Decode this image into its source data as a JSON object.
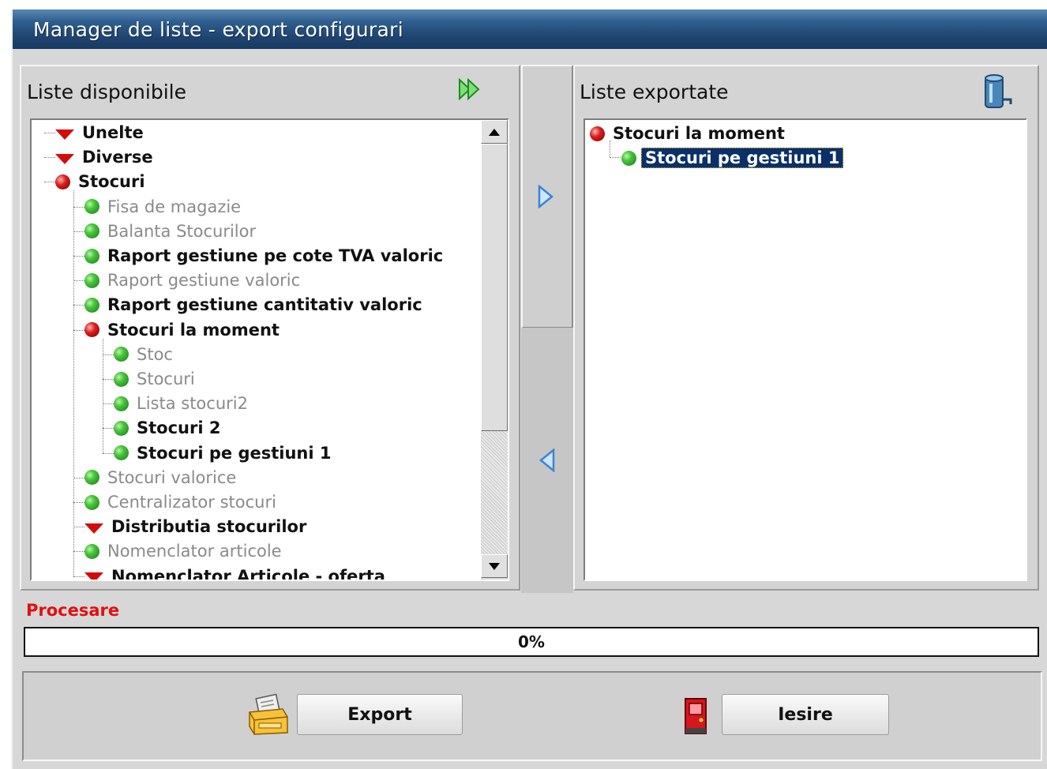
{
  "window": {
    "title": "Manager de liste  - export configurari"
  },
  "left_panel": {
    "title": "Liste disponibile",
    "add_all_icon": "double-arrow-right-icon",
    "items": [
      {
        "label": "Unelte",
        "icon": "chevron-down-icon",
        "style": "bold",
        "level": 0
      },
      {
        "label": "Diverse",
        "icon": "chevron-down-icon",
        "style": "bold",
        "level": 0
      },
      {
        "label": "Stocuri",
        "icon": "red-dot-icon",
        "style": "bold",
        "level": 0
      },
      {
        "label": "Fisa de magazie",
        "icon": "green-dot-icon",
        "style": "dim",
        "level": 1
      },
      {
        "label": "Balanta Stocurilor",
        "icon": "green-dot-icon",
        "style": "dim",
        "level": 1
      },
      {
        "label": "Raport gestiune pe cote TVA valoric",
        "icon": "green-dot-icon",
        "style": "bold",
        "level": 1
      },
      {
        "label": "Raport gestiune valoric",
        "icon": "green-dot-icon",
        "style": "dim",
        "level": 1
      },
      {
        "label": "Raport gestiune cantitativ valoric",
        "icon": "green-dot-icon",
        "style": "bold",
        "level": 1
      },
      {
        "label": "Stocuri  la moment",
        "icon": "red-dot-icon",
        "style": "bold",
        "level": 1
      },
      {
        "label": "Stoc",
        "icon": "green-dot-icon",
        "style": "dim",
        "level": 2
      },
      {
        "label": "Stocuri",
        "icon": "green-dot-icon",
        "style": "dim",
        "level": 2
      },
      {
        "label": "Lista stocuri2",
        "icon": "green-dot-icon",
        "style": "dim",
        "level": 2
      },
      {
        "label": "Stocuri 2",
        "icon": "green-dot-icon",
        "style": "bold",
        "level": 2
      },
      {
        "label": "Stocuri pe gestiuni 1",
        "icon": "green-dot-icon",
        "style": "bold",
        "level": 2
      },
      {
        "label": "Stocuri valorice",
        "icon": "green-dot-icon",
        "style": "dim",
        "level": 1
      },
      {
        "label": "Centralizator stocuri",
        "icon": "green-dot-icon",
        "style": "dim",
        "level": 1
      },
      {
        "label": "Distributia stocurilor",
        "icon": "chevron-down-icon",
        "style": "bold",
        "level": 1
      },
      {
        "label": "Nomenclator articole",
        "icon": "green-dot-icon",
        "style": "dim",
        "level": 1
      },
      {
        "label": "Nomenclator Articole - oferta",
        "icon": "chevron-down-icon",
        "style": "bold",
        "level": 1
      }
    ]
  },
  "transfer": {
    "add_icon": "arrow-right-icon",
    "remove_icon": "arrow-left-icon"
  },
  "right_panel": {
    "title": "Liste exportate",
    "trash_icon": "trash-bin-icon",
    "items": [
      {
        "label": "Stocuri  la moment",
        "icon": "red-dot-icon",
        "level": 0,
        "selected": false
      },
      {
        "label": "Stocuri pe gestiuni 1",
        "icon": "green-dot-icon",
        "level": 1,
        "selected": true
      }
    ]
  },
  "progress": {
    "label": "Procesare",
    "value": 0,
    "text": "0%"
  },
  "buttons": {
    "export": {
      "label": "Export",
      "icon": "printer-export-icon"
    },
    "exit": {
      "label": "Iesire",
      "icon": "exit-door-icon"
    }
  },
  "colors": {
    "title_bar": "#1f4470",
    "selection": "#0a2f6b",
    "progress_label": "#e01010",
    "active_dot": "#49c43b",
    "parent_dot": "#d81c1c",
    "chevron": "#d40b0b"
  }
}
